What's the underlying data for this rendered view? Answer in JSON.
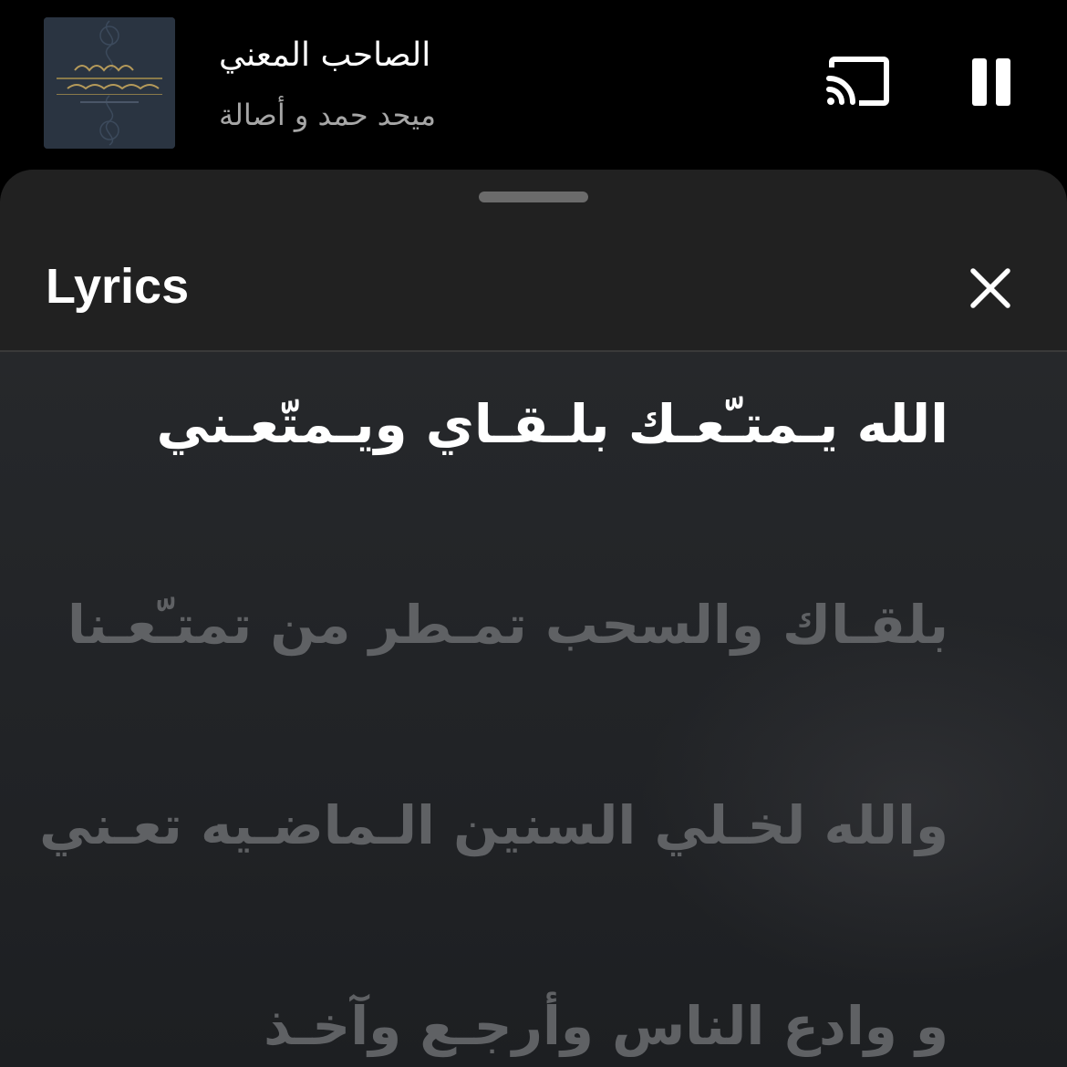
{
  "now_playing": {
    "title": "الصاحب  المعني",
    "artist": "ميحد حمد و أصالة",
    "cast_icon": "cast-icon",
    "pause_icon": "pause-icon"
  },
  "lyrics_sheet": {
    "title": "Lyrics",
    "close_icon": "close-icon",
    "lines": [
      {
        "text": "الله يـمتـّعـك بلـقـاي ويـمتّعـني",
        "active": true
      },
      {
        "text": "بلقـاك والسحب تمـطر من تمتـّعـنا",
        "active": false
      },
      {
        "text": "والله لخـلي السنين الـماضـيه تعـني",
        "active": false
      },
      {
        "text": "و وادع الناس وأرجـع وآخـذ",
        "active": false
      }
    ]
  },
  "colors": {
    "background": "#000000",
    "sheet": "#212121",
    "active_lyric": "#ffffff",
    "inactive_lyric": "#5f6164",
    "artist_text": "#a6a6a6"
  }
}
